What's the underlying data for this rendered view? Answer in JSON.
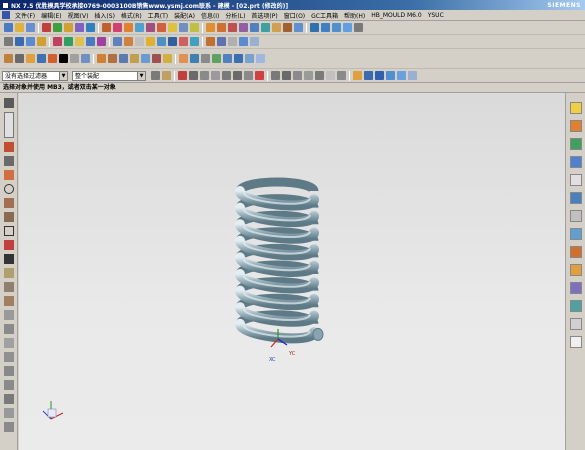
{
  "window": {
    "title": "NX 7.5 优胜模具学校承接0769-0003100B销售www.ysmj.com联系 - 建模 - [02.prt (修改的)]",
    "brand": "SIEMENS"
  },
  "menu": {
    "items": [
      "文件(F)",
      "编辑(E)",
      "视图(V)",
      "插入(S)",
      "格式(R)",
      "工具(T)",
      "装配(A)",
      "信息(I)",
      "分析(L)",
      "首选项(P)",
      "窗口(O)",
      "GC工具箱",
      "帮助(H)",
      "HB_MOULD M6.0",
      "YSUC"
    ]
  },
  "selection": {
    "filter": "没有选择过滤器",
    "scope": "整个装配"
  },
  "cue": "选择对象并使用 MB3，或者双击某一对象",
  "triad": {
    "x": "XC",
    "y": "YC"
  },
  "colors": {
    "spring_light": "#e4eef2",
    "spring_dark": "#5e7a86",
    "accent_blue": "#0a246a"
  }
}
